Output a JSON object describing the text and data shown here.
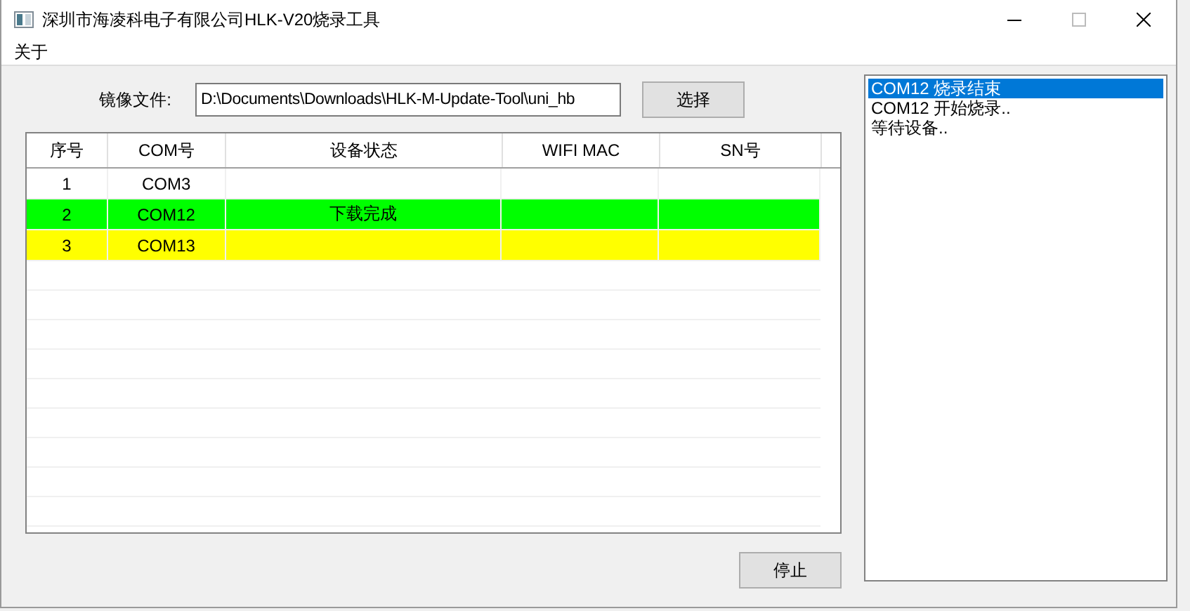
{
  "window": {
    "title": "深圳市海凌科电子有限公司HLK-V20烧录工具"
  },
  "menu": [
    "关于"
  ],
  "image_file": {
    "label": "镜像文件:",
    "value": "D:\\Documents\\Downloads\\HLK-M-Update-Tool\\uni_hb",
    "button": "选择"
  },
  "table": {
    "columns": [
      "序号",
      "COM号",
      "设备状态",
      "WIFI MAC",
      "SN号"
    ],
    "rows": [
      {
        "cells": [
          "1",
          "COM3",
          "",
          "",
          ""
        ]
      },
      {
        "cells": [
          "2",
          "COM12",
          "下载完成",
          "",
          ""
        ],
        "color": "#00ff00"
      },
      {
        "cells": [
          "3",
          "COM13",
          "",
          "",
          ""
        ],
        "color": "#ffff00"
      }
    ]
  },
  "stop_button": "停止",
  "log": [
    {
      "text": "COM12 烧录结束",
      "selected": true
    },
    {
      "text": "COM12 开始烧录..",
      "selected": false
    },
    {
      "text": "等待设备..",
      "selected": false
    }
  ]
}
